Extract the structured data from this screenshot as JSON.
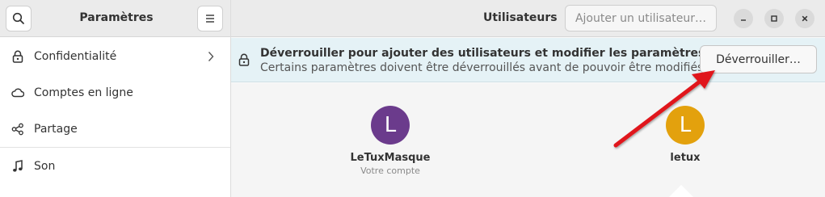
{
  "left": {
    "title": "Paramètres",
    "search_icon": "search-icon",
    "menu_icon": "hamburger-menu-icon"
  },
  "sidebar": {
    "items": [
      {
        "label": "Confidentialité",
        "icon": "lock-icon"
      },
      {
        "label": "Comptes en ligne",
        "icon": "cloud-icon"
      },
      {
        "label": "Partage",
        "icon": "share-icon"
      },
      {
        "label": "Son",
        "icon": "music-note-icon"
      }
    ]
  },
  "header": {
    "title": "Utilisateurs",
    "add_user_label": "Ajouter un utilisateur…"
  },
  "info_bar": {
    "title": "Déverrouiller pour ajouter des utilisateurs et modifier les paramètres",
    "subtitle": "Certains paramètres doivent être déverrouillés avant de pouvoir être modifiés.",
    "unlock_label": "Déverrouiller…"
  },
  "users": [
    {
      "initial": "L",
      "name": "LeTuxMasque",
      "subtitle": "Votre compte",
      "color": "#6b3b8c"
    },
    {
      "initial": "L",
      "name": "letux",
      "subtitle": "",
      "color": "#e3a10d"
    }
  ],
  "colors": {
    "info_bar_bg": "#e5f2f6",
    "annotation_arrow": "#e0191b"
  }
}
